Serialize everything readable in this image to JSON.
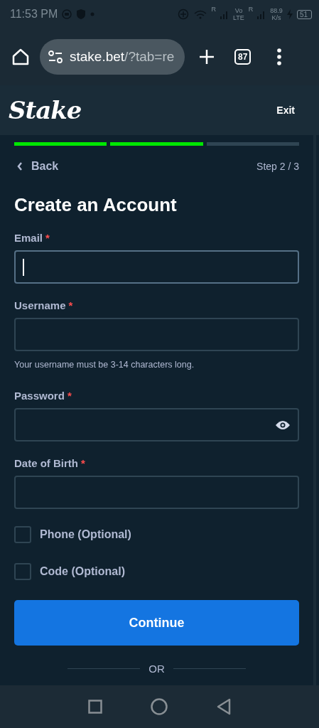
{
  "status_bar": {
    "time": "11:53 PM",
    "sim1_roaming": "R",
    "volte_top": "Vo",
    "volte_bottom": "LTE",
    "sim2_roaming": "R",
    "speed_value": "88.9",
    "speed_unit": "K/s",
    "battery": "51"
  },
  "browser_bar": {
    "url_host": "stake.bet",
    "url_path": "/?tab=re",
    "tab_count": "87"
  },
  "header": {
    "logo": "Stake",
    "exit": "Exit"
  },
  "progress": [
    {
      "done": true
    },
    {
      "done": true
    },
    {
      "done": false
    }
  ],
  "nav": {
    "back": "Back",
    "step": "Step 2 / 3"
  },
  "title": "Create an Account",
  "fields": [
    {
      "label": "Email",
      "required": "*",
      "focused": true,
      "kind": "text"
    },
    {
      "label": "Username",
      "required": "*",
      "focused": false,
      "kind": "text",
      "hint": "Your username must be 3-14 characters long."
    },
    {
      "label": "Password",
      "required": "*",
      "focused": false,
      "kind": "password"
    },
    {
      "label": "Date of Birth",
      "required": "*",
      "focused": false,
      "kind": "text"
    }
  ],
  "options": [
    {
      "label": "Phone (Optional)",
      "checked": false
    },
    {
      "label": "Code (Optional)",
      "checked": false
    }
  ],
  "continue": "Continue",
  "divider": "OR"
}
